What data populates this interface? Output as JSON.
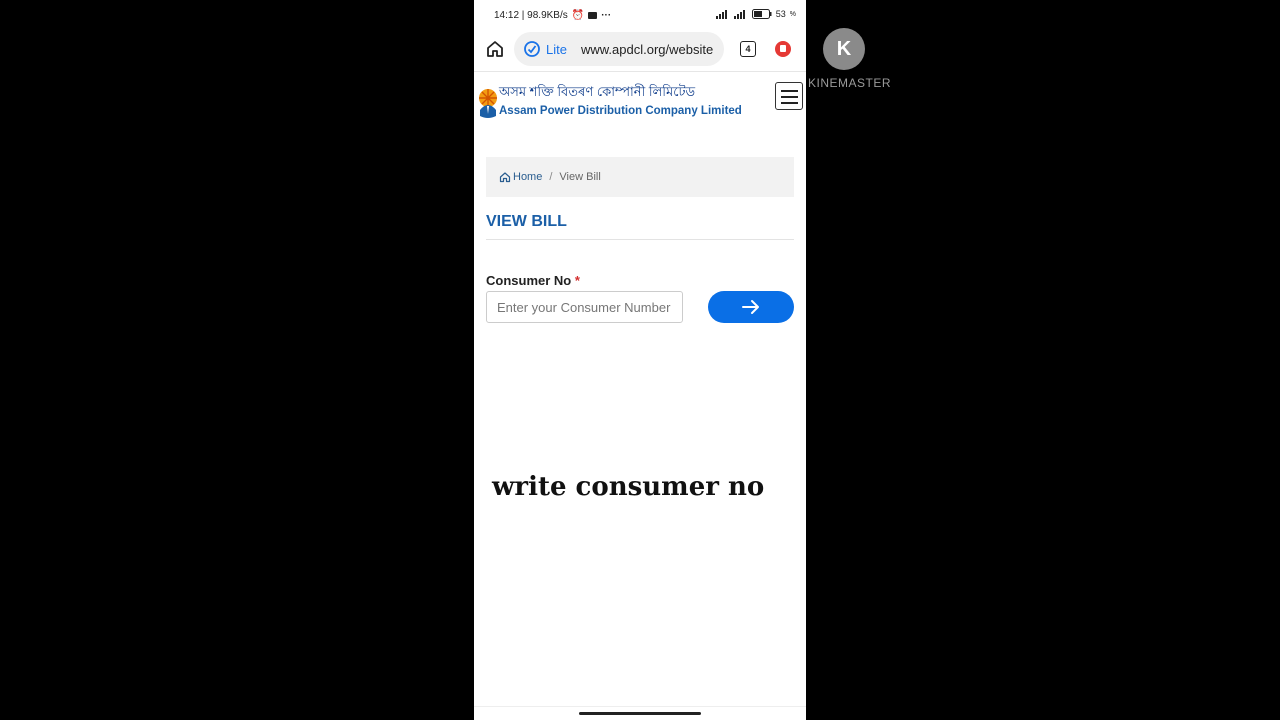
{
  "status_bar": {
    "left_text": "14:12 | 98.9KB/s",
    "battery": "53"
  },
  "browser": {
    "lite_label": "Lite",
    "url": "www.apdcl.org/website",
    "tab_count": "4"
  },
  "site": {
    "name_assamese": "অসম শক্তি বিতৰণ কোম্পানী লিমিটেড",
    "name_english": "Assam Power Distribution Company Limited"
  },
  "breadcrumb": {
    "home": "Home",
    "separator": "/",
    "current": "View Bill"
  },
  "page": {
    "title": "VIEW BILL"
  },
  "form": {
    "label": "Consumer No",
    "required_mark": "*",
    "placeholder": "Enter your Consumer Number",
    "value": ""
  },
  "overlay_caption": "write consumer no",
  "watermark": {
    "letter": "K",
    "text": "KINEMASTER"
  },
  "colors": {
    "brand_blue": "#1b5fa7",
    "button_blue": "#0a6fe6",
    "required_red": "#d32f2f"
  }
}
